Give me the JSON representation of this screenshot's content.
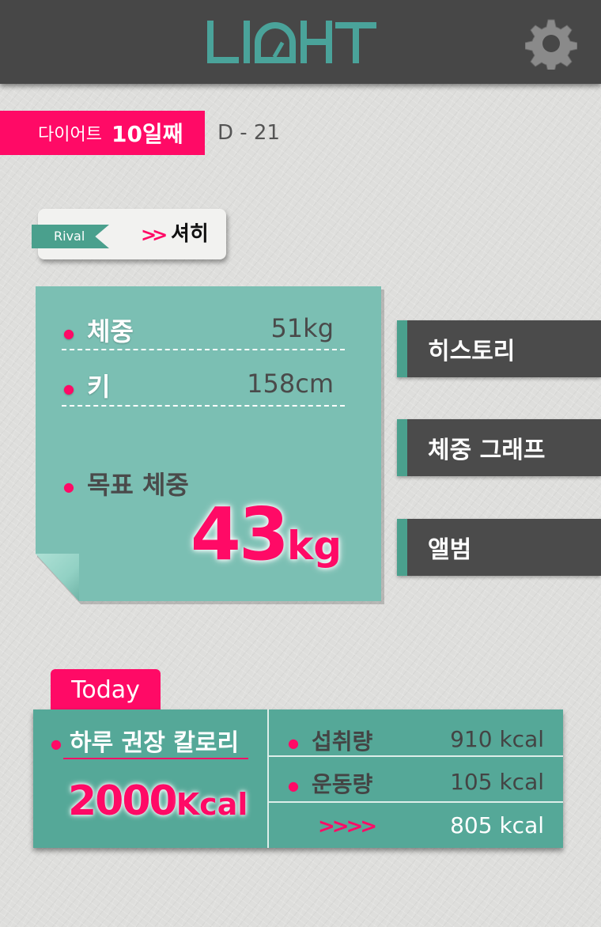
{
  "app": {
    "logo_text": "LIGHT"
  },
  "colors": {
    "accent_pink": "#ff0a66",
    "teal": "#4aa08d",
    "note_teal": "#7bbfb3",
    "dark": "#474747"
  },
  "header": {
    "settings_icon": "gear-icon"
  },
  "diet": {
    "prefix": "다이어트",
    "days": "10일째",
    "dday": "D - 21"
  },
  "rival": {
    "tag": "Rival",
    "arrows": "»",
    "name": "셔히"
  },
  "stats": {
    "weight_label": "체중",
    "weight_value": "51kg",
    "height_label": "키",
    "height_value": "158cm",
    "goal_label": "목표 체중",
    "goal_number": "43",
    "goal_unit": "kg"
  },
  "menu": {
    "history": "히스토리",
    "weight_graph": "체중 그래프",
    "album": "앨범"
  },
  "today": {
    "tab": "Today",
    "recommended_label": "하루 권장 칼로리",
    "recommended_number": "2000",
    "recommended_unit": "Kcal",
    "intake_label": "섭취량",
    "intake_value": "910 kcal",
    "exercise_label": "운동량",
    "exercise_value": "105 kcal",
    "net_arrows": "››››",
    "net_value": "805 kcal"
  }
}
